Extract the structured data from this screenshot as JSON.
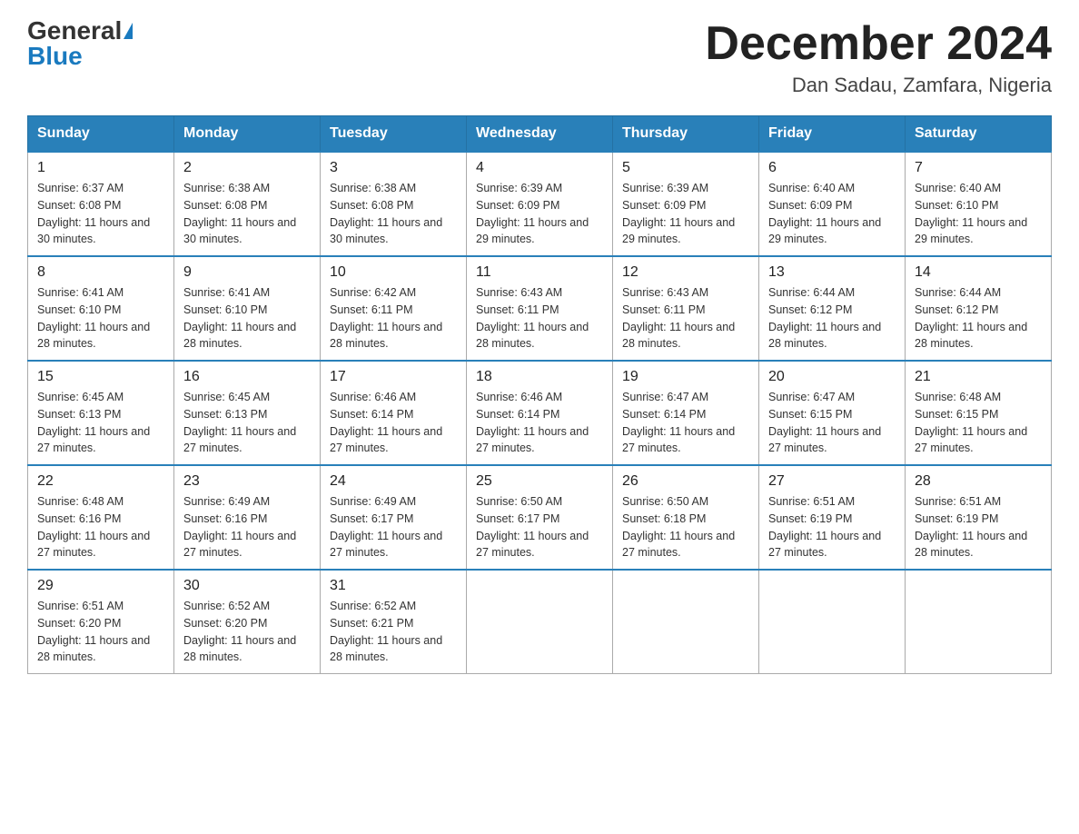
{
  "logo": {
    "general": "General",
    "blue": "Blue"
  },
  "title": "December 2024",
  "subtitle": "Dan Sadau, Zamfara, Nigeria",
  "days_of_week": [
    "Sunday",
    "Monday",
    "Tuesday",
    "Wednesday",
    "Thursday",
    "Friday",
    "Saturday"
  ],
  "weeks": [
    [
      {
        "day": "1",
        "sunrise": "6:37 AM",
        "sunset": "6:08 PM",
        "daylight": "11 hours and 30 minutes."
      },
      {
        "day": "2",
        "sunrise": "6:38 AM",
        "sunset": "6:08 PM",
        "daylight": "11 hours and 30 minutes."
      },
      {
        "day": "3",
        "sunrise": "6:38 AM",
        "sunset": "6:08 PM",
        "daylight": "11 hours and 30 minutes."
      },
      {
        "day": "4",
        "sunrise": "6:39 AM",
        "sunset": "6:09 PM",
        "daylight": "11 hours and 29 minutes."
      },
      {
        "day": "5",
        "sunrise": "6:39 AM",
        "sunset": "6:09 PM",
        "daylight": "11 hours and 29 minutes."
      },
      {
        "day": "6",
        "sunrise": "6:40 AM",
        "sunset": "6:09 PM",
        "daylight": "11 hours and 29 minutes."
      },
      {
        "day": "7",
        "sunrise": "6:40 AM",
        "sunset": "6:10 PM",
        "daylight": "11 hours and 29 minutes."
      }
    ],
    [
      {
        "day": "8",
        "sunrise": "6:41 AM",
        "sunset": "6:10 PM",
        "daylight": "11 hours and 28 minutes."
      },
      {
        "day": "9",
        "sunrise": "6:41 AM",
        "sunset": "6:10 PM",
        "daylight": "11 hours and 28 minutes."
      },
      {
        "day": "10",
        "sunrise": "6:42 AM",
        "sunset": "6:11 PM",
        "daylight": "11 hours and 28 minutes."
      },
      {
        "day": "11",
        "sunrise": "6:43 AM",
        "sunset": "6:11 PM",
        "daylight": "11 hours and 28 minutes."
      },
      {
        "day": "12",
        "sunrise": "6:43 AM",
        "sunset": "6:11 PM",
        "daylight": "11 hours and 28 minutes."
      },
      {
        "day": "13",
        "sunrise": "6:44 AM",
        "sunset": "6:12 PM",
        "daylight": "11 hours and 28 minutes."
      },
      {
        "day": "14",
        "sunrise": "6:44 AM",
        "sunset": "6:12 PM",
        "daylight": "11 hours and 28 minutes."
      }
    ],
    [
      {
        "day": "15",
        "sunrise": "6:45 AM",
        "sunset": "6:13 PM",
        "daylight": "11 hours and 27 minutes."
      },
      {
        "day": "16",
        "sunrise": "6:45 AM",
        "sunset": "6:13 PM",
        "daylight": "11 hours and 27 minutes."
      },
      {
        "day": "17",
        "sunrise": "6:46 AM",
        "sunset": "6:14 PM",
        "daylight": "11 hours and 27 minutes."
      },
      {
        "day": "18",
        "sunrise": "6:46 AM",
        "sunset": "6:14 PM",
        "daylight": "11 hours and 27 minutes."
      },
      {
        "day": "19",
        "sunrise": "6:47 AM",
        "sunset": "6:14 PM",
        "daylight": "11 hours and 27 minutes."
      },
      {
        "day": "20",
        "sunrise": "6:47 AM",
        "sunset": "6:15 PM",
        "daylight": "11 hours and 27 minutes."
      },
      {
        "day": "21",
        "sunrise": "6:48 AM",
        "sunset": "6:15 PM",
        "daylight": "11 hours and 27 minutes."
      }
    ],
    [
      {
        "day": "22",
        "sunrise": "6:48 AM",
        "sunset": "6:16 PM",
        "daylight": "11 hours and 27 minutes."
      },
      {
        "day": "23",
        "sunrise": "6:49 AM",
        "sunset": "6:16 PM",
        "daylight": "11 hours and 27 minutes."
      },
      {
        "day": "24",
        "sunrise": "6:49 AM",
        "sunset": "6:17 PM",
        "daylight": "11 hours and 27 minutes."
      },
      {
        "day": "25",
        "sunrise": "6:50 AM",
        "sunset": "6:17 PM",
        "daylight": "11 hours and 27 minutes."
      },
      {
        "day": "26",
        "sunrise": "6:50 AM",
        "sunset": "6:18 PM",
        "daylight": "11 hours and 27 minutes."
      },
      {
        "day": "27",
        "sunrise": "6:51 AM",
        "sunset": "6:19 PM",
        "daylight": "11 hours and 27 minutes."
      },
      {
        "day": "28",
        "sunrise": "6:51 AM",
        "sunset": "6:19 PM",
        "daylight": "11 hours and 28 minutes."
      }
    ],
    [
      {
        "day": "29",
        "sunrise": "6:51 AM",
        "sunset": "6:20 PM",
        "daylight": "11 hours and 28 minutes."
      },
      {
        "day": "30",
        "sunrise": "6:52 AM",
        "sunset": "6:20 PM",
        "daylight": "11 hours and 28 minutes."
      },
      {
        "day": "31",
        "sunrise": "6:52 AM",
        "sunset": "6:21 PM",
        "daylight": "11 hours and 28 minutes."
      },
      null,
      null,
      null,
      null
    ]
  ]
}
